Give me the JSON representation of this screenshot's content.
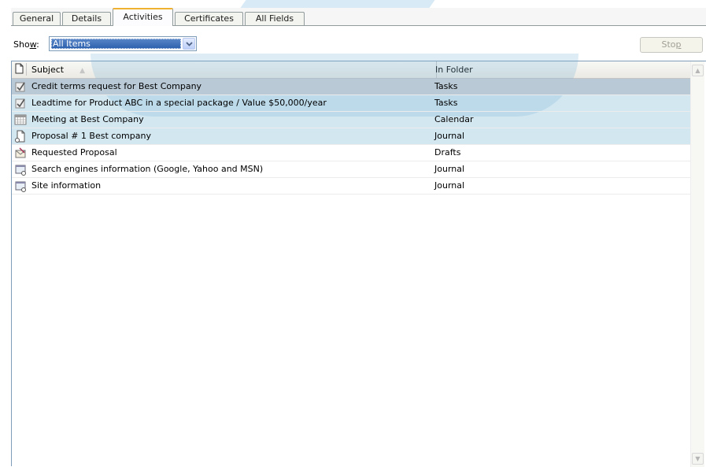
{
  "tabs": [
    "General",
    "Details",
    "Activities",
    "Certificates",
    "All Fields"
  ],
  "active_tab": "Activities",
  "show": {
    "label_pre": "Sho",
    "label_accel": "w",
    "label_post": ":",
    "value": "All Items"
  },
  "stop_button": {
    "label_pre": "Sto",
    "label_accel": "p"
  },
  "columns": {
    "subject": "Subject",
    "folder": "In Folder"
  },
  "rows": [
    {
      "icon": "task-icon",
      "subject": "Credit terms  request for Best Company",
      "folder": "Tasks"
    },
    {
      "icon": "task-icon",
      "subject": "Leadtime for Product ABC in a special package / Value $50,000/year",
      "folder": "Tasks"
    },
    {
      "icon": "calendar-icon",
      "subject": "Meeting at Best Company",
      "folder": "Calendar"
    },
    {
      "icon": "journal-document-icon",
      "subject": "Proposal # 1 Best company",
      "folder": "Journal"
    },
    {
      "icon": "draft-envelope-icon",
      "subject": "Requested Proposal",
      "folder": "Drafts"
    },
    {
      "icon": "journal-web-icon",
      "subject": "Search engines information (Google, Yahoo and MSN)",
      "folder": "Journal"
    },
    {
      "icon": "journal-web-icon",
      "subject": "Site information",
      "folder": "Journal"
    }
  ]
}
